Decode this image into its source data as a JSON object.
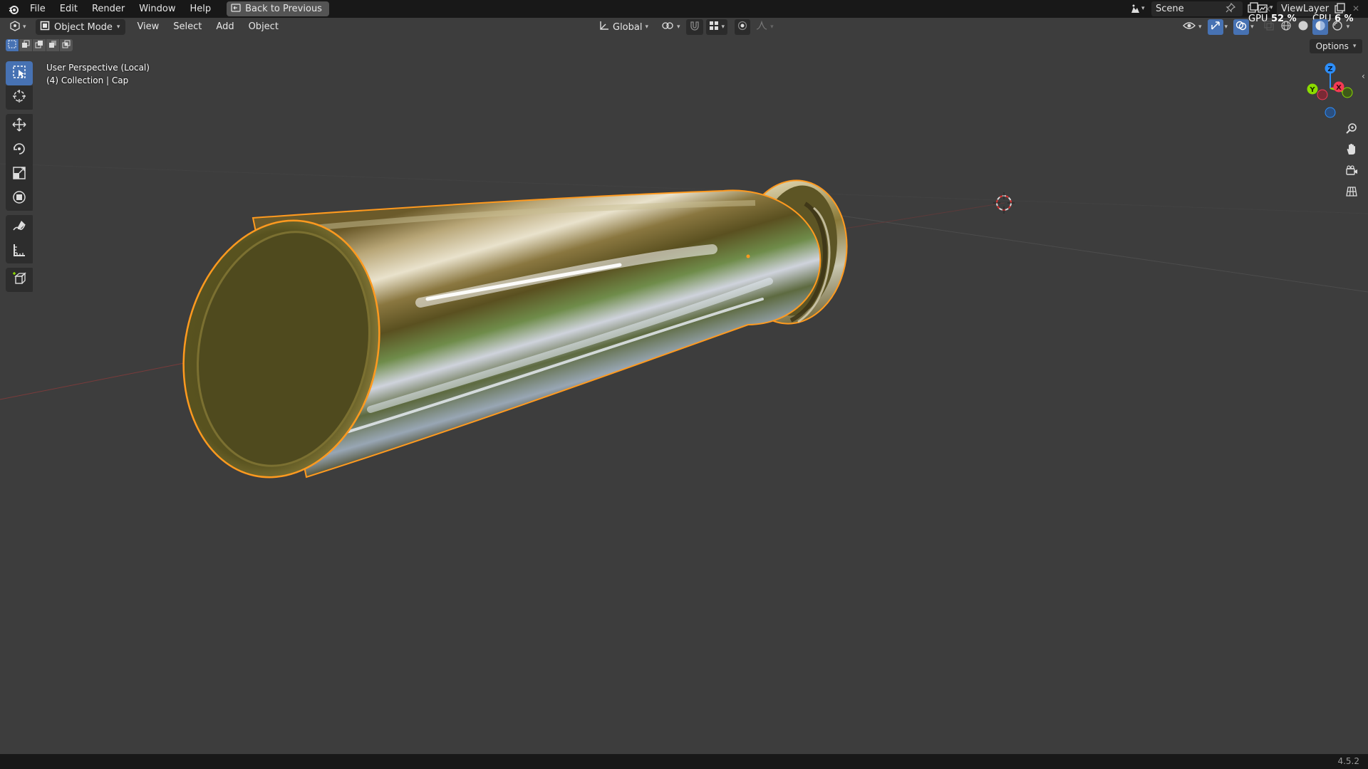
{
  "topbar": {
    "menu": [
      "File",
      "Edit",
      "Render",
      "Window",
      "Help"
    ],
    "back_button": "Back to Previous",
    "scene_name": "Scene",
    "view_layer": "ViewLayer",
    "gpu_label": "GPU",
    "gpu_value": "52 %",
    "cpu_label": "CPU",
    "cpu_value": "6 %"
  },
  "viewport_header": {
    "mode": "Object Mode",
    "menus": [
      "View",
      "Select",
      "Add",
      "Object"
    ],
    "transform_orientation": "Global",
    "options_label": "Options"
  },
  "toolbar": {
    "tools": [
      {
        "name": "select-box-tool",
        "icon": "select-box-icon",
        "active": true
      },
      {
        "name": "cursor-tool",
        "icon": "cursor-icon"
      },
      {
        "name": "move-tool",
        "icon": "move-icon"
      },
      {
        "name": "rotate-tool",
        "icon": "rotate-icon"
      },
      {
        "name": "scale-tool",
        "icon": "scale-icon"
      },
      {
        "name": "transform-tool",
        "icon": "transform-icon"
      },
      {
        "name": "annotate-tool",
        "icon": "annotate-icon"
      },
      {
        "name": "measure-tool",
        "icon": "measure-icon"
      },
      {
        "name": "add-cube-tool",
        "icon": "add-cube-icon"
      }
    ]
  },
  "viewport": {
    "perspective_label": "User Perspective (Local)",
    "collection_label": "(4) Collection | Cap",
    "object_name": "Cap"
  },
  "gizmo": {
    "axes": [
      "X",
      "Y",
      "Z"
    ],
    "colors": {
      "x": "#f53a54",
      "y": "#8bdc00",
      "z": "#2c8fff"
    }
  },
  "colors": {
    "accent": "#4772b3",
    "selection_outline": "#ff9a1f",
    "background": "#3d3d3d"
  },
  "statusbar": {
    "version": "4.5.2"
  }
}
